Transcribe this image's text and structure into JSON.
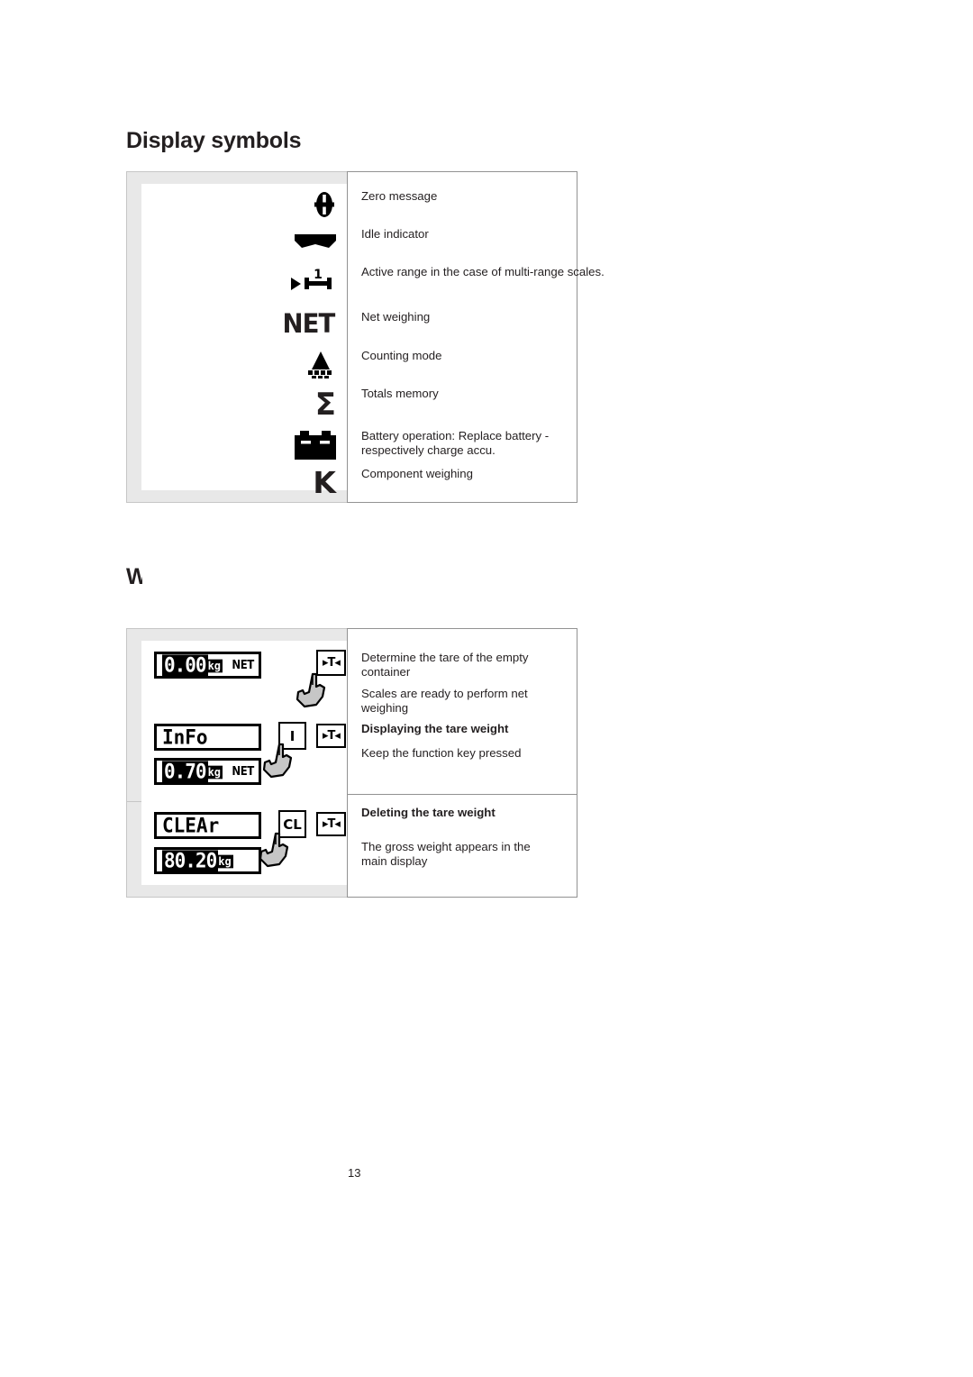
{
  "document": {
    "page_number": "13",
    "section_title": "Display symbols",
    "clipped_heading": "Weighing with tare"
  },
  "symbols_table": {
    "rows": [
      {
        "icon": "zero-message-icon",
        "glyph_text": "",
        "description": "Zero message"
      },
      {
        "icon": "idle-indicator-icon",
        "glyph_text": "",
        "description": "Idle indicator"
      },
      {
        "icon": "active-range-icon",
        "glyph_text": "1",
        "description": "Active range in the case of multi-range scales."
      },
      {
        "icon": "net-icon",
        "glyph_text": "NET",
        "description": "Net weighing"
      },
      {
        "icon": "counting-mode-icon",
        "glyph_text": "",
        "description": "Counting mode"
      },
      {
        "icon": "totals-memory-icon",
        "glyph_text": "Σ",
        "description": "Totals memory"
      },
      {
        "icon": "battery-icon",
        "glyph_text": "",
        "description": "Battery operation: Replace battery - respectively charge accu."
      },
      {
        "icon": "component-weighing-icon",
        "glyph_text": "K",
        "description": "Component weighing"
      }
    ]
  },
  "net_weighing_table": {
    "displays": {
      "lcd1_value": "0.00",
      "lcd1_unit": "kg",
      "lcd1_flag": "NET",
      "lcd2_word": "InFo",
      "lcd3_value": "0.70",
      "lcd3_unit": "kg",
      "lcd3_flag": "NET",
      "lcd4_word": "CLEAr",
      "lcd5_value": "80.20",
      "lcd5_unit": "kg"
    },
    "keys": {
      "tare_left": "▸T◂",
      "tare_mid": "▸T◂",
      "tare_bottom": "▸T◂",
      "info": "I",
      "clear": "CL"
    },
    "descriptions": {
      "line1": "Determine the tare of the empty container",
      "line2": "Scales are ready to perform net weighing",
      "line3_bold": "Displaying the tare weight",
      "line4": "Keep the function key pressed",
      "line5_bold": "Deleting the tare weight",
      "line6": "The gross weight appears in the main display"
    }
  }
}
